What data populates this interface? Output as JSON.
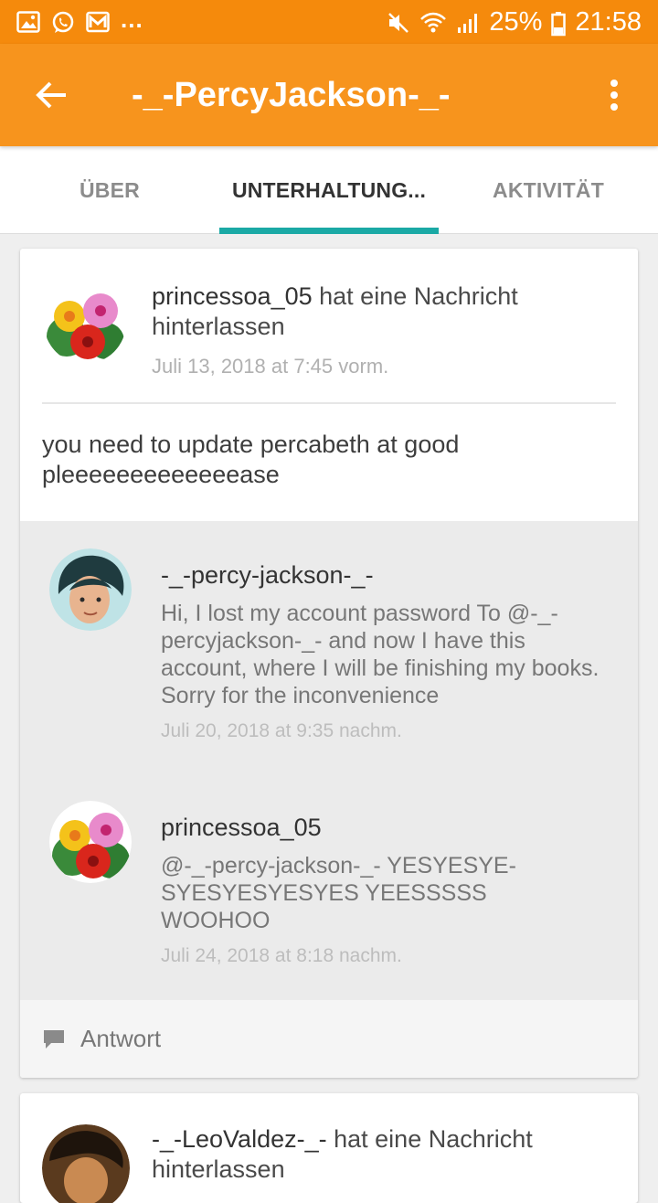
{
  "status_bar": {
    "notification_icons": [
      "gallery-icon",
      "whatsapp-icon",
      "mail-icon"
    ],
    "overflow": "...",
    "battery_pct": "25%",
    "time": "21:58"
  },
  "app_bar": {
    "title": "-_-PercyJackson-_-",
    "accent_color": "#f7941d"
  },
  "tabs": [
    {
      "label": "ÜBER",
      "active": false
    },
    {
      "label": "UNTERHALTUNG...",
      "active": true
    },
    {
      "label": "AKTIVITÄT",
      "active": false
    }
  ],
  "conversation": {
    "author": "princessoa_05",
    "action": "hat eine Nachricht hinterlassen",
    "date": "Juli 13, 2018 at 7:45 vorm.",
    "message": "you need to update percabeth at good pleeeeeeeeeeeeease",
    "replies": [
      {
        "user": "-_-percy-jackson-_-",
        "text": "Hi, I lost my account password  To @-_-percyjackson-_- and now I have this account, where I will be finishing my books. Sorry for the  inconvenience",
        "date": "Juli 20, 2018 at 9:35 nachm."
      },
      {
        "user": "princessoa_05",
        "text": "@-_-percy-jackson-_- YESYESYE-SYESYESYESYES YEESSSSS WOOHOO",
        "date": "Juli 24, 2018 at 8:18 nachm."
      }
    ],
    "reply_label": "Antwort"
  },
  "next_conversation": {
    "author": "-_-LeoValdez-_-",
    "action": "hat eine Nachricht hinterlassen"
  }
}
